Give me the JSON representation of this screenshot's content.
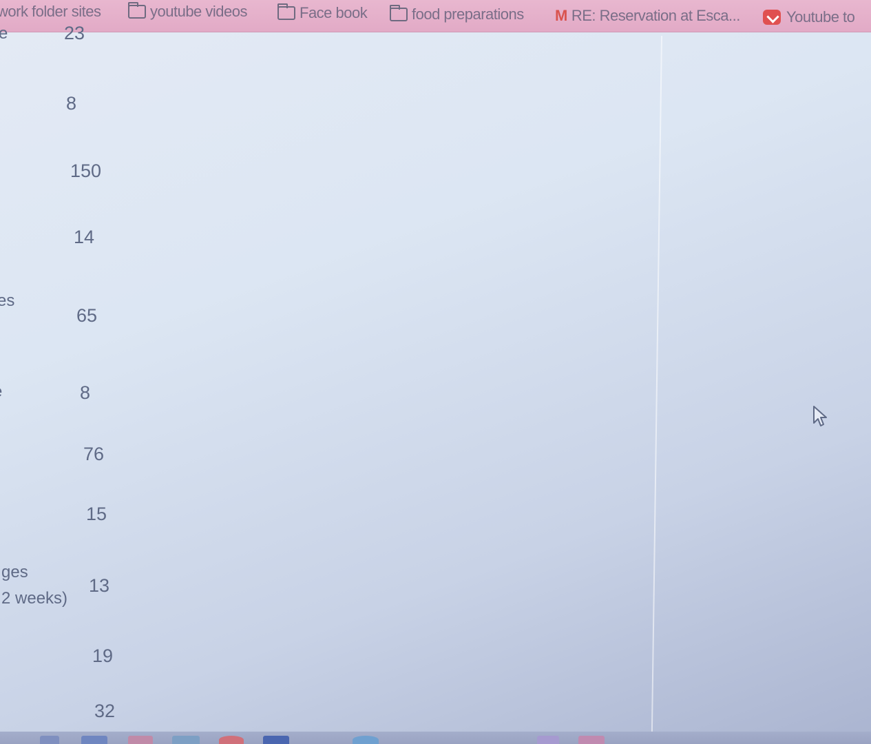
{
  "bookmarks": [
    {
      "label": "work folder sites",
      "icon": "none"
    },
    {
      "label": "youtube videos",
      "icon": "folder-icon"
    },
    {
      "label": "Face book",
      "icon": "folder-icon"
    },
    {
      "label": "food preparations",
      "icon": "folder-icon"
    },
    {
      "label": "RE: Reservation at Esca...",
      "icon": "gmail-icon"
    },
    {
      "label": "Youtube to",
      "icon": "youtube-to-mp3-icon"
    }
  ],
  "labels": {
    "row1": "e",
    "row5": "es",
    "row6": "e",
    "row9_line1": "ges",
    "row9_line2": "2 weeks)"
  },
  "values": [
    "23",
    "8",
    "150",
    "14",
    "65",
    "8",
    "76",
    "15",
    "13",
    "19",
    "32"
  ],
  "colors": {
    "bookmarks_bar": "#e2aac6",
    "text": "#5f6a86",
    "background": "#dce6f3"
  }
}
